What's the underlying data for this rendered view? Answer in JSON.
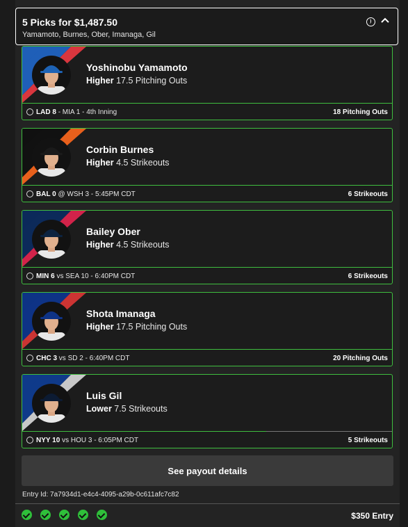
{
  "header": {
    "title": "5 Picks for $1,487.50",
    "players_summary": "Yamamoto, Burnes, Ober, Imanaga, Gil",
    "icons": [
      "baseball-icon",
      "chevron-up-icon"
    ]
  },
  "picks": [
    {
      "name": "Yoshinobu Yamamoto",
      "direction": "Higher",
      "line": "17.5 Pitching Outs",
      "game_team": "LAD 8",
      "game_rest": "- MIA 1 - 4th Inning",
      "stat": "18 Pitching Outs",
      "stripe_colors": [
        "#d9363e",
        "#1f5fb8"
      ],
      "cap_color": "#1e63b5"
    },
    {
      "name": "Corbin Burnes",
      "direction": "Higher",
      "line": "4.5 Strikeouts",
      "game_team": "BAL 0",
      "game_rest": "@ WSH 3 - 5:45PM CDT",
      "stat": "6 Strikeouts",
      "stripe_colors": [
        "#e8601c",
        "#111111"
      ],
      "cap_color": "#1a1a1a"
    },
    {
      "name": "Bailey Ober",
      "direction": "Higher",
      "line": "4.5 Strikeouts",
      "game_team": "MIN 6",
      "game_rest": "vs SEA 10 - 6:40PM CDT",
      "stat": "6 Strikeouts",
      "stripe_colors": [
        "#d2234a",
        "#0c2a5a"
      ],
      "cap_color": "#0c2340"
    },
    {
      "name": "Shota Imanaga",
      "direction": "Higher",
      "line": "17.5 Pitching Outs",
      "game_team": "CHC 3",
      "game_rest": "vs SD 2 - 6:40PM CDT",
      "stat": "20 Pitching Outs",
      "stripe_colors": [
        "#cc3433",
        "#0e3386"
      ],
      "cap_color": "#0e3386"
    },
    {
      "name": "Luis Gil",
      "direction": "Lower",
      "line": "7.5 Strikeouts",
      "game_team": "NYY 10",
      "game_rest": "vs HOU 3 - 6:05PM CDT",
      "stat": "5 Strikeouts",
      "stripe_colors": [
        "#c8c8c8",
        "#0f3a8a"
      ],
      "cap_color": "#0c1b33",
      "progress": 0.66
    }
  ],
  "payout_button": "See payout details",
  "entry_id": "Entry Id: 7a7934d1-e4c4-4095-a29b-0c611afc7c82",
  "entry_amount": "$350 Entry",
  "checks": 5,
  "accent_color": "#3fbf3f"
}
